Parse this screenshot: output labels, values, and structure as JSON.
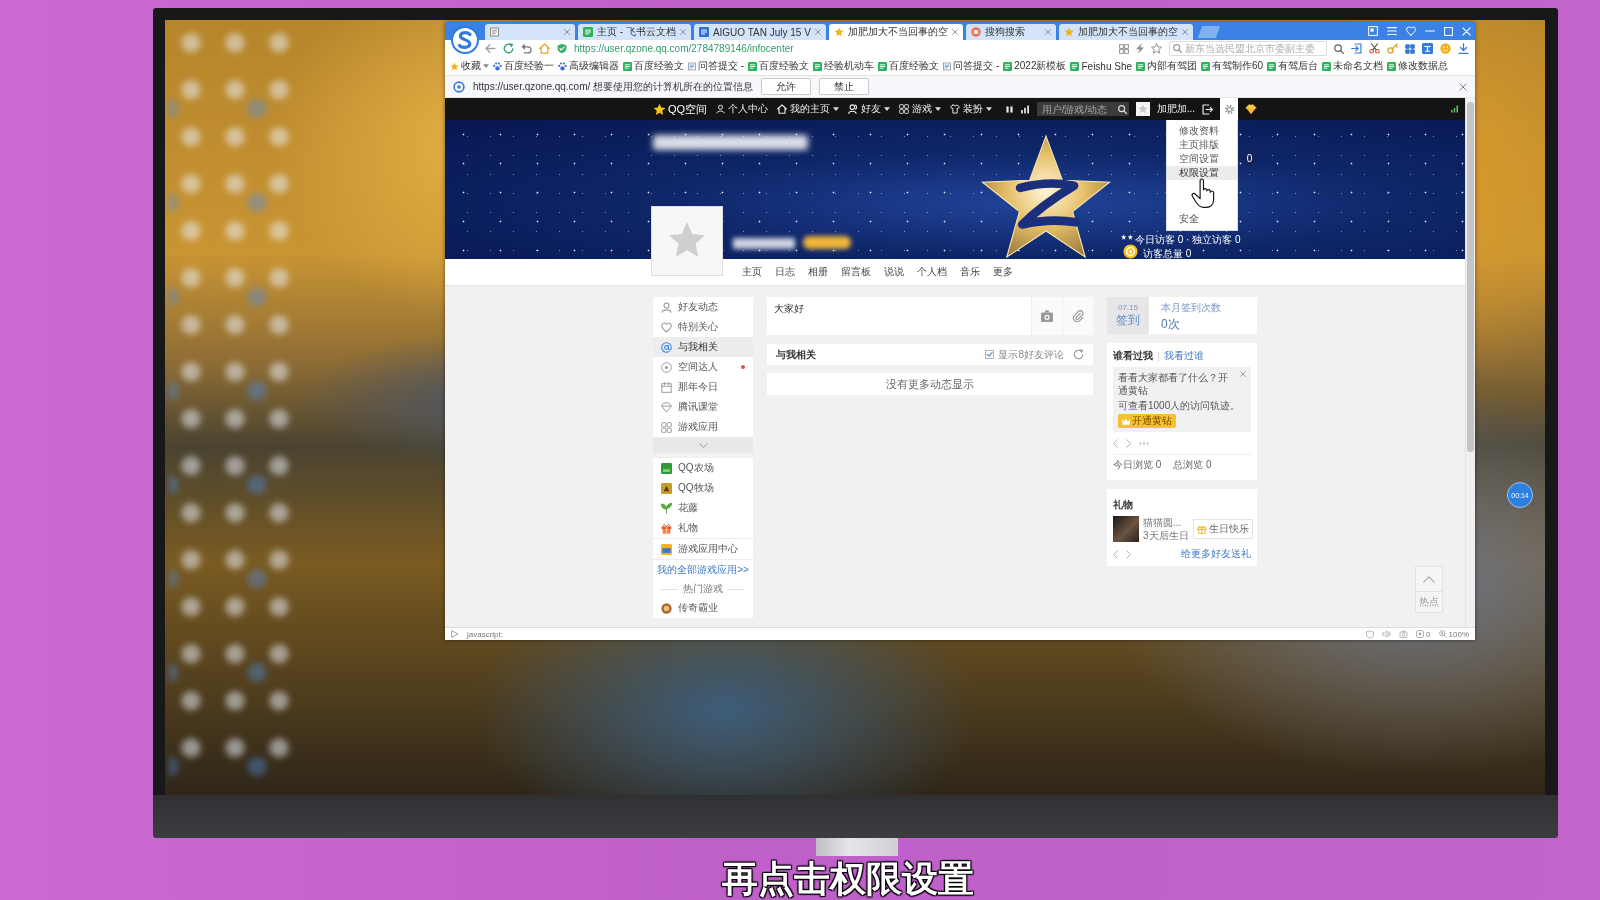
{
  "subtitle": "再点击权限设置",
  "desktop": {
    "timer": "00:14"
  },
  "browser": {
    "tabs": [
      {
        "selected": false
      },
      {
        "title": "主页 - 飞书云文档",
        "selected": false
      },
      {
        "title": "AIGUO TAN July 15 V",
        "selected": false
      },
      {
        "title": "加肥加大不当回事的空",
        "selected": true
      },
      {
        "title": "搜狗搜索",
        "selected": false
      },
      {
        "title": "加肥加大不当回事的空",
        "selected": false
      }
    ],
    "url": "https://user.qzone.qq.com/2784789146/infocenter",
    "search": {
      "placeholder": "新东当选民盟北京市委副主委"
    },
    "bookmarks": [
      {
        "label": "收藏",
        "dropdown": true
      },
      {
        "label": "百度经验一",
        "dropdown": false
      },
      {
        "label": "高级编辑器",
        "dropdown": false
      },
      {
        "label": "百度经验文",
        "dropdown": false
      },
      {
        "label": "问答提交 -",
        "dropdown": false
      },
      {
        "label": "百度经验文",
        "dropdown": false
      },
      {
        "label": "经验机动车",
        "dropdown": false
      },
      {
        "label": "百度经验文",
        "dropdown": false
      },
      {
        "label": "问答提交 -",
        "dropdown": false
      },
      {
        "label": "2022新模板",
        "dropdown": false
      },
      {
        "label": "Feishu She",
        "dropdown": false
      },
      {
        "label": "内部有驾团",
        "dropdown": false
      },
      {
        "label": "有驾制作60",
        "dropdown": false
      },
      {
        "label": "有驾后台",
        "dropdown": false
      },
      {
        "label": "未命名文档",
        "dropdown": false
      },
      {
        "label": "修改数据总",
        "dropdown": false
      }
    ],
    "notification": {
      "message": "https://user.qzone.qq.com/ 想要使用您的计算机所在的位置信息",
      "buttons": [
        "允许",
        "禁止"
      ]
    },
    "status_bar": {
      "text": "javascript:",
      "count": "0",
      "zoom": "100%"
    }
  },
  "qzone": {
    "nav": {
      "brand": "QQ空间",
      "items": [
        {
          "label": "个人中心",
          "dropdown": false
        },
        {
          "label": "我的主页",
          "dropdown": true
        },
        {
          "label": "好友",
          "dropdown": true
        },
        {
          "label": "游戏",
          "dropdown": true
        },
        {
          "label": "装扮",
          "dropdown": true
        }
      ],
      "search": {
        "placeholder": "用户/游戏/动态"
      },
      "user_name": "加肥加..."
    },
    "settings_menu": [
      {
        "label": "修改资料",
        "selected": false
      },
      {
        "label": "主页排版",
        "selected": false
      },
      {
        "label": "空间设置",
        "selected": false
      },
      {
        "label": "权限设置",
        "selected": true
      },
      {
        "label": "安全",
        "selected": false
      }
    ],
    "banner": {
      "counter": "0",
      "visitors_today": "今日访客 0 · 独立访客 0",
      "visitors_total": "访客总量 0"
    },
    "tabs": [
      "主页",
      "日志",
      "相册",
      "留言板",
      "说说",
      "个人档",
      "音乐",
      "更多"
    ],
    "sidebar": {
      "items": [
        {
          "label": "好友动态",
          "selected": false,
          "red_dot": false
        },
        {
          "label": "特别关心",
          "selected": false,
          "red_dot": false
        },
        {
          "label": "与我相关",
          "selected": true,
          "red_dot": false
        },
        {
          "label": "空间达人",
          "selected": false,
          "red_dot": true
        },
        {
          "label": "那年今日",
          "selected": false,
          "red_dot": false
        },
        {
          "label": "腾讯课堂",
          "selected": false,
          "red_dot": false
        },
        {
          "label": "游戏应用",
          "selected": false,
          "red_dot": false
        }
      ],
      "apps": [
        "QQ农场",
        "QQ牧场",
        "花藤",
        "礼物"
      ],
      "app_center": "游戏应用中心",
      "all_apps_link": "我的全部游戏应用>>",
      "hot_games_title": "热门游戏",
      "hot_games": [
        "传奇霸业"
      ]
    },
    "composer": {
      "value": "大家好"
    },
    "feed_filter": {
      "title": "与我相关",
      "checkbox_label": "显示8好友评论",
      "checked": true
    },
    "feed_empty": "没有更多动态显示",
    "checkin": {
      "date": "07.15",
      "button": "签到",
      "count_label": "本月签到次数",
      "count": "0次"
    },
    "visitors": {
      "tabs": [
        {
          "label": "谁看过我",
          "selected": true
        },
        {
          "label": "我看过谁",
          "selected": false
        }
      ],
      "tip": "看看大家都看了什么？开通黄钻",
      "tip_detail": "可查看1000人的访问轨迹。",
      "tip_button": "开通黄钻",
      "stats": [
        "今日浏览 0",
        "总浏览 0"
      ]
    },
    "gifts": {
      "title": "礼物",
      "friend_name": "猫猫圆...",
      "friend_note": "3天后生日",
      "button": "生日快乐",
      "link": "给更多好友送礼"
    },
    "side_tools": {
      "label": "热点"
    }
  }
}
